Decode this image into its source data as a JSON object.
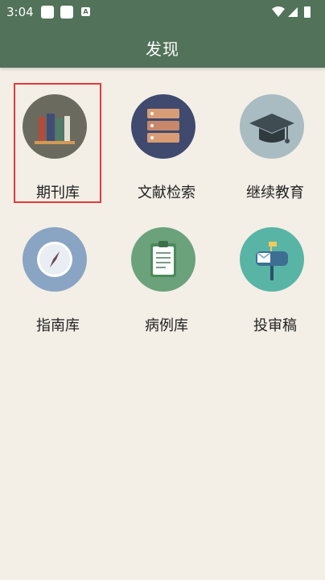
{
  "status_bar": {
    "time": "3:04",
    "icons": [
      "notification-square-icon",
      "notification-square-icon",
      "a-icon",
      "wifi-icon",
      "signal-icon",
      "battery-icon"
    ]
  },
  "app_bar": {
    "title": "发现"
  },
  "colors": {
    "primary": "#527259",
    "background": "#f3efe6",
    "selection": "#e23a3a"
  },
  "grid": {
    "items": [
      {
        "label": "期刊库",
        "icon": "books-icon",
        "circle_color": "#6b6a5e",
        "selected": true
      },
      {
        "label": "文献检索",
        "icon": "server-icon",
        "circle_color": "#3f4a6e",
        "selected": false
      },
      {
        "label": "继续教育",
        "icon": "graduation-cap-icon",
        "circle_color": "#a9bcc1",
        "selected": false
      },
      {
        "label": "指南库",
        "icon": "compass-icon",
        "circle_color": "#8aa4c4",
        "selected": false
      },
      {
        "label": "病例库",
        "icon": "clipboard-icon",
        "circle_color": "#6ba27c",
        "selected": false
      },
      {
        "label": "投审稿",
        "icon": "mailbox-icon",
        "circle_color": "#58b5a6",
        "selected": false
      }
    ]
  }
}
